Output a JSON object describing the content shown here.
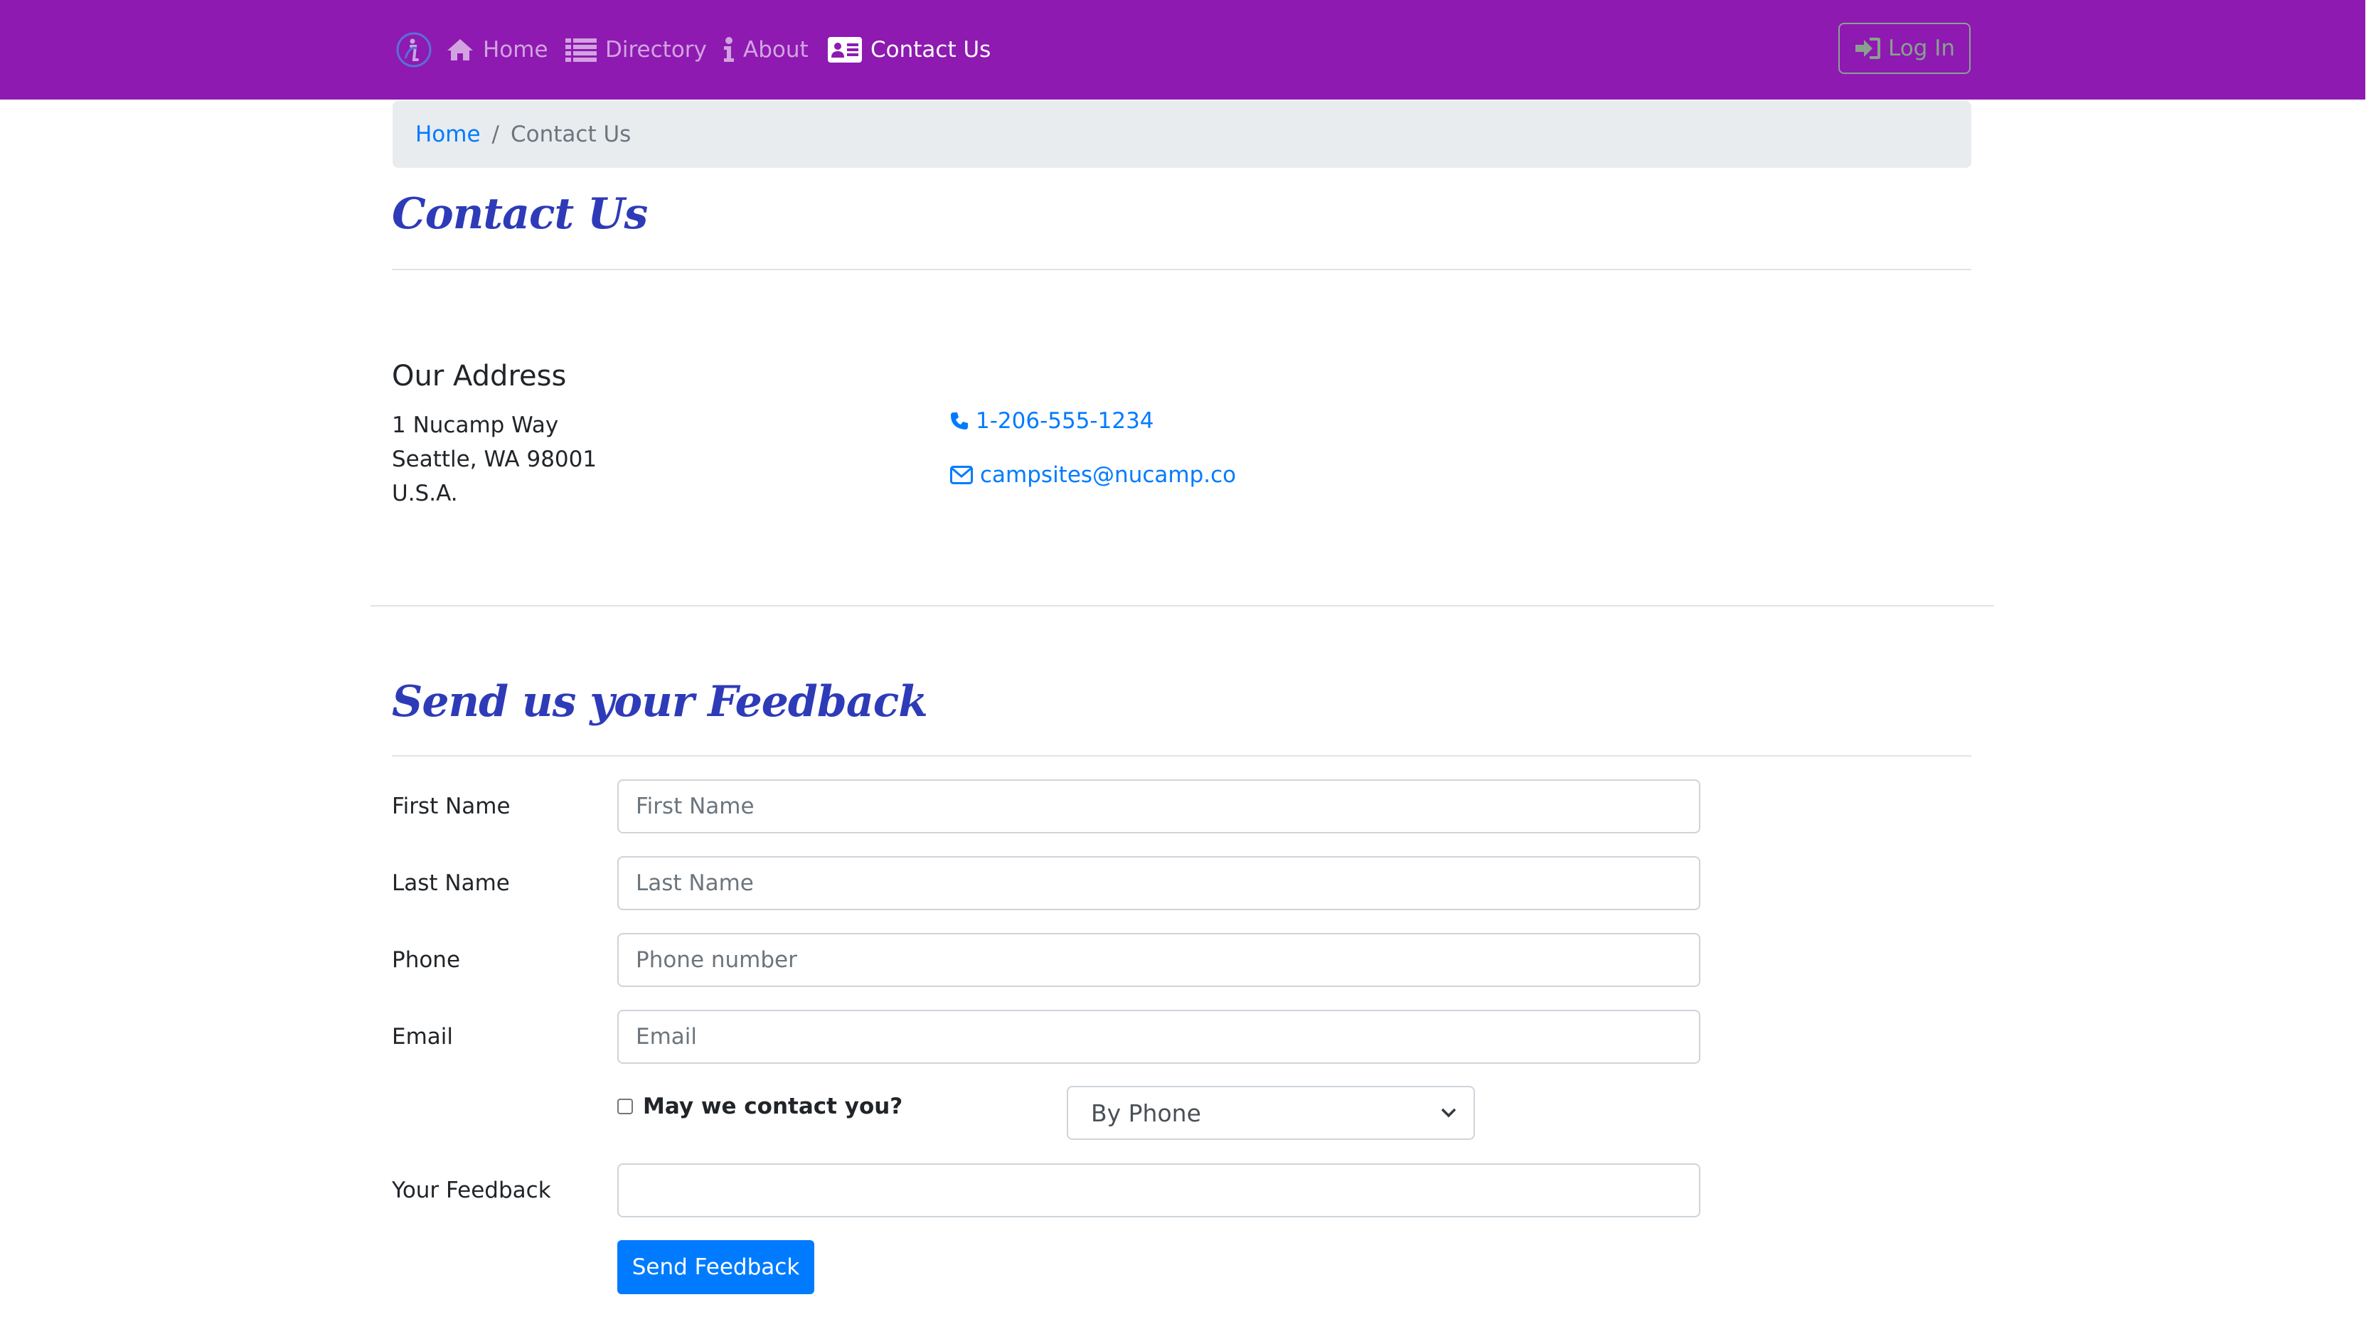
{
  "navbar": {
    "bg_color": "#8e1ab1",
    "brand_icon": "nucamp-logo-icon",
    "items": [
      {
        "label": "Home",
        "icon": "home-icon",
        "active": false
      },
      {
        "label": "Directory",
        "icon": "list-icon",
        "active": false
      },
      {
        "label": "About",
        "icon": "info-icon",
        "active": false
      },
      {
        "label": "Contact Us",
        "icon": "address-card-icon",
        "active": true
      }
    ],
    "login": {
      "label": "Log In",
      "icon": "sign-in-icon"
    }
  },
  "breadcrumb": {
    "home": "Home",
    "separator": "/",
    "current": "Contact Us"
  },
  "page": {
    "title": "Contact Us"
  },
  "address": {
    "title": "Our Address",
    "lines": [
      "1 Nucamp Way",
      "Seattle, WA 98001",
      "U.S.A."
    ],
    "phone": "1-206-555-1234",
    "phone_icon": "phone-icon",
    "email": "campsites@nucamp.co",
    "email_icon": "envelope-icon"
  },
  "feedback": {
    "title": "Send us your Feedback",
    "first_name": {
      "label": "First Name",
      "placeholder": "First Name",
      "value": ""
    },
    "last_name": {
      "label": "Last Name",
      "placeholder": "Last Name",
      "value": ""
    },
    "phone": {
      "label": "Phone",
      "placeholder": "Phone number",
      "value": ""
    },
    "email": {
      "label": "Email",
      "placeholder": "Email",
      "value": ""
    },
    "contact_check": {
      "label": "May we contact you?",
      "checked": false
    },
    "contact_method": {
      "selected": "By Phone"
    },
    "message": {
      "label": "Your Feedback",
      "value": ""
    },
    "submit_label": "Send Feedback"
  },
  "colors": {
    "accent": "#007bff",
    "heading": "#2e3bb8",
    "login_outline": "#8aa08f"
  }
}
